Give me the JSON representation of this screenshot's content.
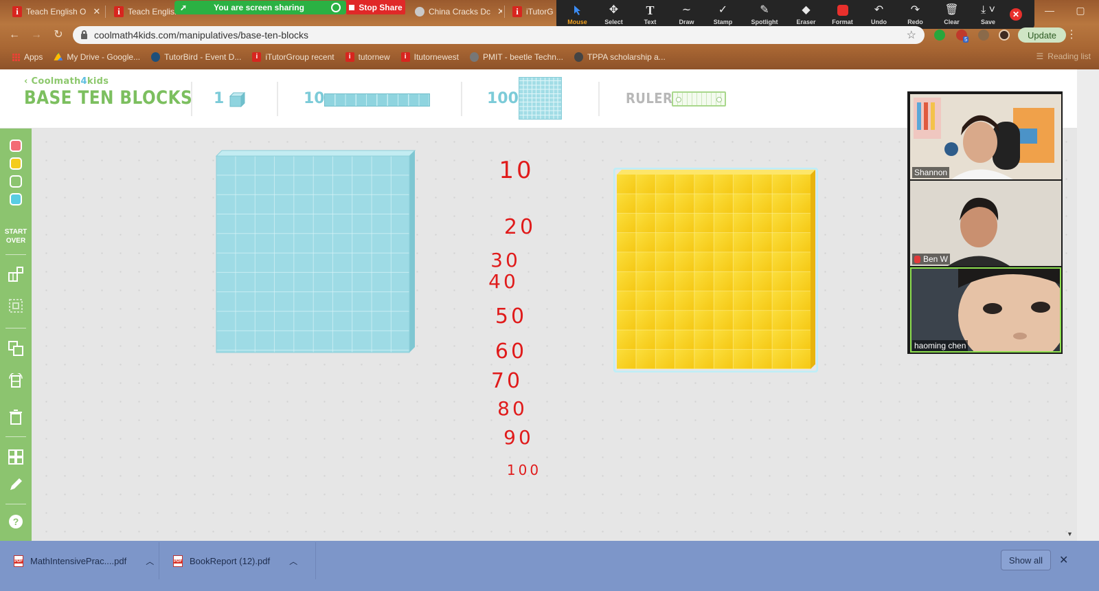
{
  "browser": {
    "tabs": [
      {
        "label": "Teach English O",
        "icon": "itutor-favicon"
      },
      {
        "label": "Teach English",
        "icon": "itutor-favicon"
      },
      {
        "label": "China Cracks Dc",
        "icon": "generic-favicon"
      },
      {
        "label": "iTutorG",
        "icon": "itutor-favicon"
      }
    ],
    "url": "coolmath4kids.com/manipulatives/base-ten-blocks",
    "update_label": "Update",
    "ext_badge": "5",
    "bookmarks": [
      {
        "label": "Apps",
        "icon": "apps-grid-icon"
      },
      {
        "label": "My Drive - Google...",
        "icon": "drive-icon"
      },
      {
        "label": "TutorBird - Event D...",
        "icon": "tutorbird-icon"
      },
      {
        "label": "iTutorGroup recent",
        "icon": "itutor-favicon"
      },
      {
        "label": "tutornew",
        "icon": "itutor-favicon"
      },
      {
        "label": "Itutornewest",
        "icon": "itutor-favicon"
      },
      {
        "label": "PMIT - beetle Techn...",
        "icon": "globe-icon"
      },
      {
        "label": "TPPA scholarship a...",
        "icon": "tppa-icon"
      }
    ],
    "reading_list": "Reading list"
  },
  "zoom": {
    "sharing_text": "You are screen sharing",
    "stop_share_label": "Stop Share",
    "tools": [
      {
        "label": "Mouse",
        "icon": "cursor-icon",
        "active": true
      },
      {
        "label": "Select",
        "icon": "move-icon",
        "active": false
      },
      {
        "label": "Text",
        "icon": "text-icon",
        "active": false
      },
      {
        "label": "Draw",
        "icon": "draw-icon",
        "active": false
      },
      {
        "label": "Stamp",
        "icon": "check-icon",
        "active": false
      },
      {
        "label": "Spotlight",
        "icon": "wand-icon",
        "active": false
      },
      {
        "label": "Eraser",
        "icon": "eraser-icon",
        "active": false
      },
      {
        "label": "Format",
        "icon": "color-swatch-icon",
        "active": false
      },
      {
        "label": "Undo",
        "icon": "undo-icon",
        "active": false
      },
      {
        "label": "Redo",
        "icon": "redo-icon",
        "active": false
      },
      {
        "label": "Clear",
        "icon": "trash-icon",
        "active": false
      },
      {
        "label": "Save",
        "icon": "save-icon",
        "active": false
      }
    ],
    "participants": [
      {
        "name": "Shannon",
        "muted": false,
        "active": false
      },
      {
        "name": "Ben W",
        "muted": true,
        "active": false
      },
      {
        "name": "haoming   chen",
        "muted": false,
        "active": true
      }
    ],
    "annotation_color": "#e01b1b"
  },
  "app": {
    "brand": "Coolmath",
    "brand_four": "4",
    "brand_kids": "kids",
    "title": "BASE TEN BLOCKS",
    "pieces": [
      {
        "label": "1",
        "icon": "unit-cube-icon"
      },
      {
        "label": "10",
        "icon": "ten-rod-icon"
      },
      {
        "label": "100",
        "icon": "hundred-flat-icon"
      }
    ],
    "ruler_label": "RULER",
    "start_over_label_1": "START",
    "start_over_label_2": "OVER",
    "colors": {
      "red": "#f36b75",
      "yellow": "#f4cc1c",
      "green": "#8cc46f",
      "blue": "#59cde3",
      "sidebar": "#8cc46f"
    },
    "blocks": [
      {
        "type": "hundred-flat",
        "color": "blue"
      },
      {
        "type": "hundred-flat",
        "color": "yellow"
      }
    ]
  },
  "annotations": [
    "10",
    "20",
    "30",
    "40",
    "50",
    "60",
    "70",
    "80",
    "90",
    "100"
  ],
  "downloads": {
    "files": [
      {
        "name": "MathIntensivePrac....pdf",
        "icon": "pdf-icon"
      },
      {
        "name": "BookReport (12).pdf",
        "icon": "pdf-icon"
      }
    ],
    "show_all": "Show all"
  }
}
